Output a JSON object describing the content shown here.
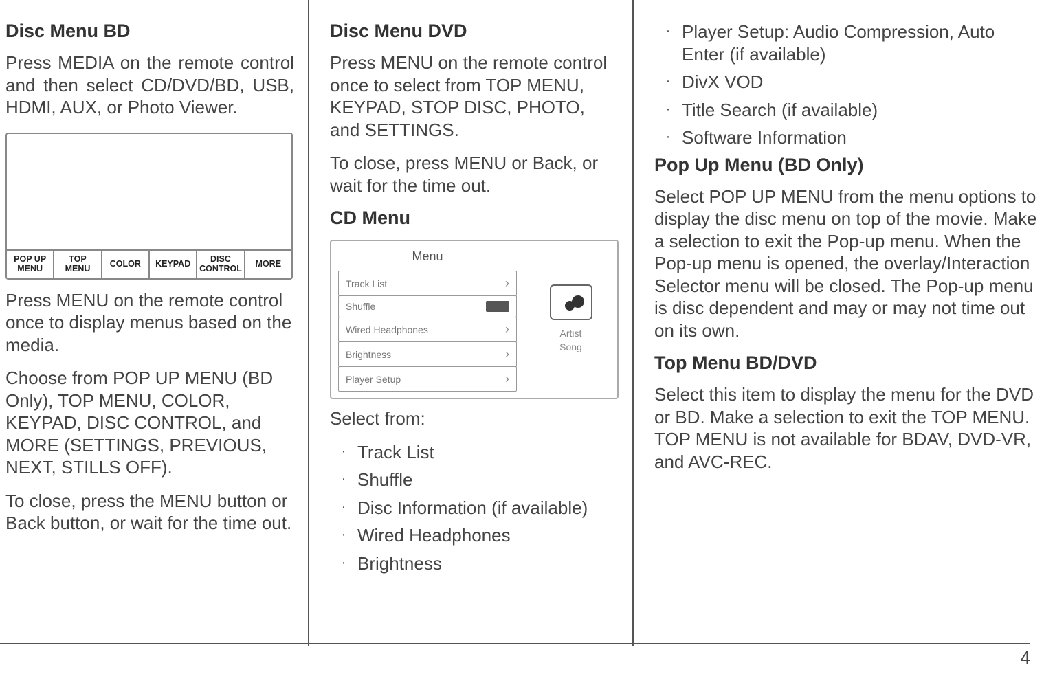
{
  "page_number": "4",
  "col1": {
    "h_bd": "Disc Menu BD",
    "p_bd_1": "Press MEDIA on the remote control and then select CD/DVD/BD, USB, HDMI, AUX, or Photo Viewer.",
    "toolbar": {
      "popup": "POP UP\nMENU",
      "top": "TOP\nMENU",
      "color": "COLOR",
      "keypad": "KEYPAD",
      "disc": "DISC\nCONTROL",
      "more": "MORE"
    },
    "p_bd_2": "Press MENU on the remote control once to display menus based on the media.",
    "p_bd_3": "Choose from POP UP MENU (BD Only), TOP MENU, COLOR, KEYPAD, DISC CONTROL, and MORE (SETTINGS, PREVIOUS, NEXT, STILLS OFF).",
    "p_bd_4": "To close, press the MENU button or Back button, or wait for the time out."
  },
  "col2": {
    "h_dvd": "Disc Menu DVD",
    "p_dvd_1": "Press MENU on the remote control once to select from TOP MENU, KEYPAD, STOP DISC, PHOTO, and SETTINGS.",
    "p_dvd_2": "To close, press MENU or Back, or wait for the time out.",
    "h_cd": "CD Menu",
    "cd_fig": {
      "title": "Menu",
      "items": {
        "tracklist": "Track List",
        "shuffle": "Shuffle",
        "wired": "Wired Headphones",
        "brightness": "Brightness",
        "player": "Player Setup"
      },
      "artist": "Artist",
      "song": "Song"
    },
    "select_from": "Select from:",
    "list": {
      "i1": "Track List",
      "i2": "Shuffle",
      "i3": "Disc Information (if available)",
      "i4": "Wired Headphones",
      "i5": "Brightness"
    }
  },
  "col3": {
    "list_top": {
      "i1": "Player Setup: Audio Compression, Auto Enter (if available)",
      "i2": "DivX VOD",
      "i3": "Title Search (if available)",
      "i4": "Software Information"
    },
    "h_popup": "Pop Up Menu (BD Only)",
    "p_popup": "Select POP UP MENU from the menu options to display the disc menu on top of the movie. Make a selection to exit the Pop-up menu. When the Pop-up menu is opened, the overlay/Interaction Selector menu will be closed. The Pop-up menu is disc dependent and may or may not time out on its own.",
    "h_top": "Top Menu BD/DVD",
    "p_top": "Select this item to display the menu for the DVD or BD. Make a selection to exit the TOP MENU. TOP MENU is not available for BDAV, DVD-VR, and AVC-REC."
  }
}
